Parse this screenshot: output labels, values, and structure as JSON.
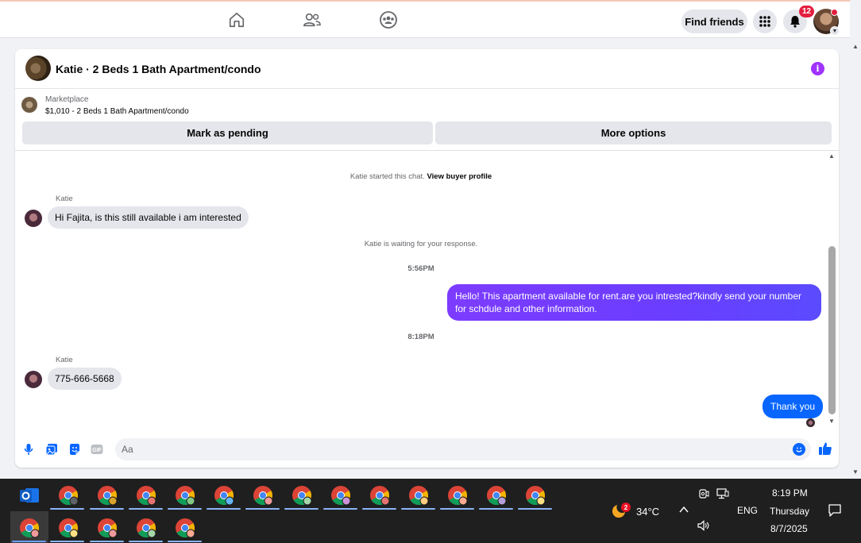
{
  "topbar": {
    "find_friends": "Find friends",
    "notification_count": "12"
  },
  "chat": {
    "title": "Katie · 2 Beds 1 Bath Apartment/condo",
    "marketplace_label": "Marketplace",
    "listing": "$1,010 - 2 Beds 1 Bath Apartment/condo",
    "mark_pending": "Mark as pending",
    "more_options": "More options",
    "started_text": "Katie started this chat.",
    "view_profile": "View buyer profile",
    "waiting_text": "Katie is waiting for your response.",
    "messages": [
      {
        "sender": "Katie",
        "text": "Hi Fajita, is this still available i am interested"
      },
      {
        "time": "5:56PM"
      },
      {
        "sender": "me",
        "text": "Hello! This apartment available for rent.are you intrested?kindly send your number for schdule and other information."
      },
      {
        "time": "8:18PM"
      },
      {
        "sender": "Katie",
        "text": "775-666-5668"
      },
      {
        "sender": "me",
        "text": "Thank you"
      }
    ],
    "composer_placeholder": "Aa"
  },
  "taskbar": {
    "weather_temp": "34°C",
    "weather_badge": "2",
    "language": "ENG",
    "time": "8:19 PM",
    "day": "Thursday",
    "date": "8/7/2025"
  },
  "colors": {
    "accent_blue": "#0866ff",
    "accent_purple": "#7d3cff",
    "info_purple": "#a033ff",
    "badge_red": "#e41e3f"
  }
}
